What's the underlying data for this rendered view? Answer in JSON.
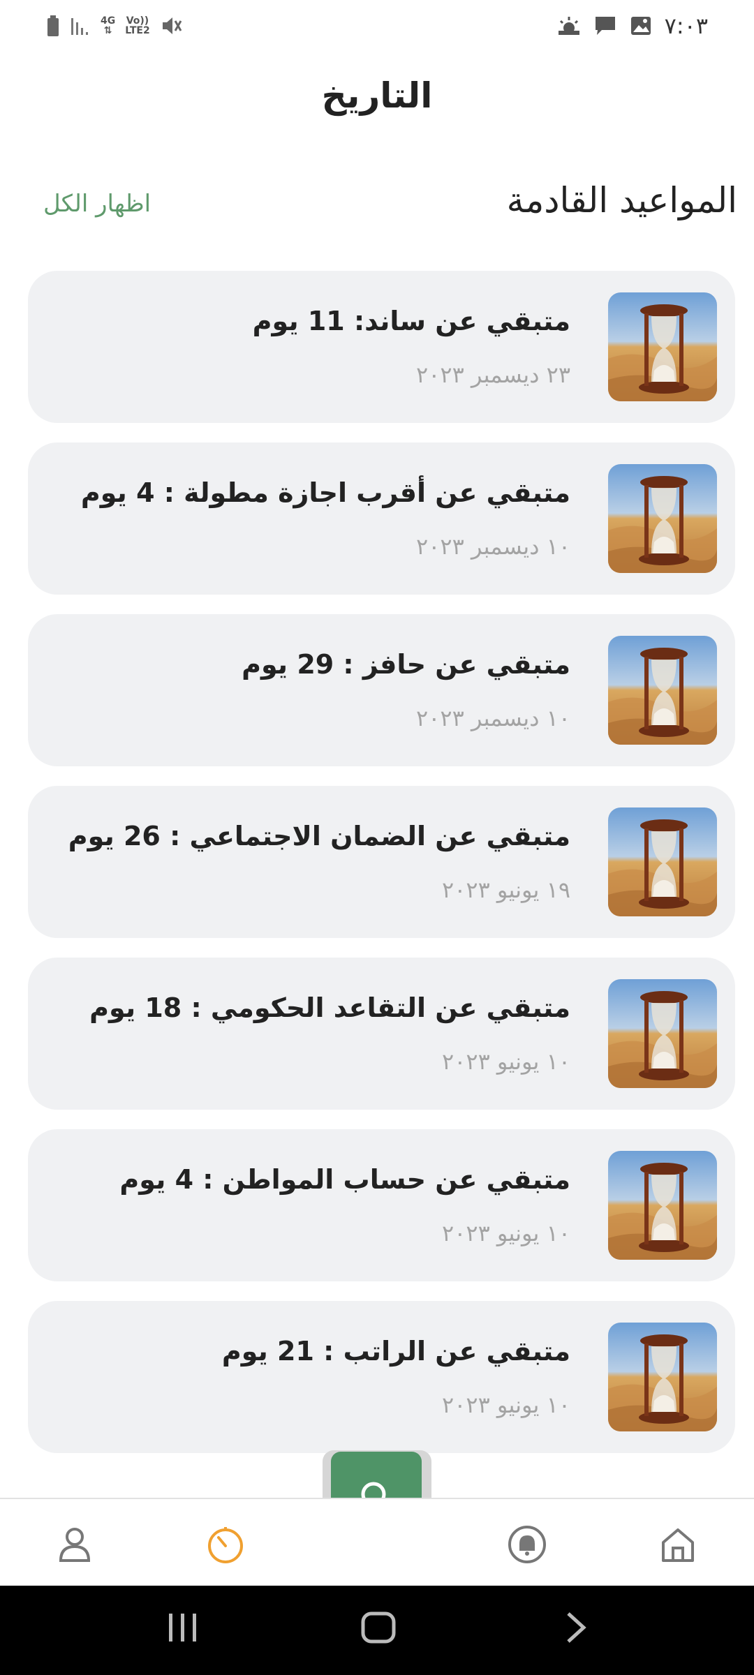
{
  "status_bar": {
    "time": "٧:٠٣",
    "network": "4G",
    "volte": "Vo))",
    "lte": "LTE2"
  },
  "header": {
    "title": "التاريخ",
    "section_title": "المواعيد القادمة",
    "show_all": "اظهار الكل"
  },
  "appointments": [
    {
      "title": "متبقي عن ساند: 11 يوم",
      "date": "٢٣ ديسمبر ٢٠٢٣"
    },
    {
      "title": "متبقي عن أقرب اجازة مطولة : 4 يوم",
      "date": "١٠ ديسمبر ٢٠٢٣"
    },
    {
      "title": "متبقي عن حافز : 29 يوم",
      "date": "١٠ ديسمبر ٢٠٢٣"
    },
    {
      "title": "متبقي عن الضمان الاجتماعي : 26 يوم",
      "date": "١٩ يونيو ٢٠٢٣"
    },
    {
      "title": "متبقي عن التقاعد الحكومي : 18 يوم",
      "date": "١٠ يونيو ٢٠٢٣"
    },
    {
      "title": "متبقي عن حساب المواطن : 4 يوم",
      "date": "١٠ يونيو ٢٠٢٣"
    },
    {
      "title": "متبقي عن الراتب : 21 يوم",
      "date": "١٠ يونيو ٢٠٢٣"
    }
  ],
  "colors": {
    "accent": "#4f9467",
    "active_tab": "#f0a030",
    "card_bg": "#f0f1f3"
  },
  "nav": {
    "items": [
      "profile-icon",
      "timer-icon",
      "bell-icon",
      "home-icon"
    ],
    "active": "timer-icon"
  }
}
